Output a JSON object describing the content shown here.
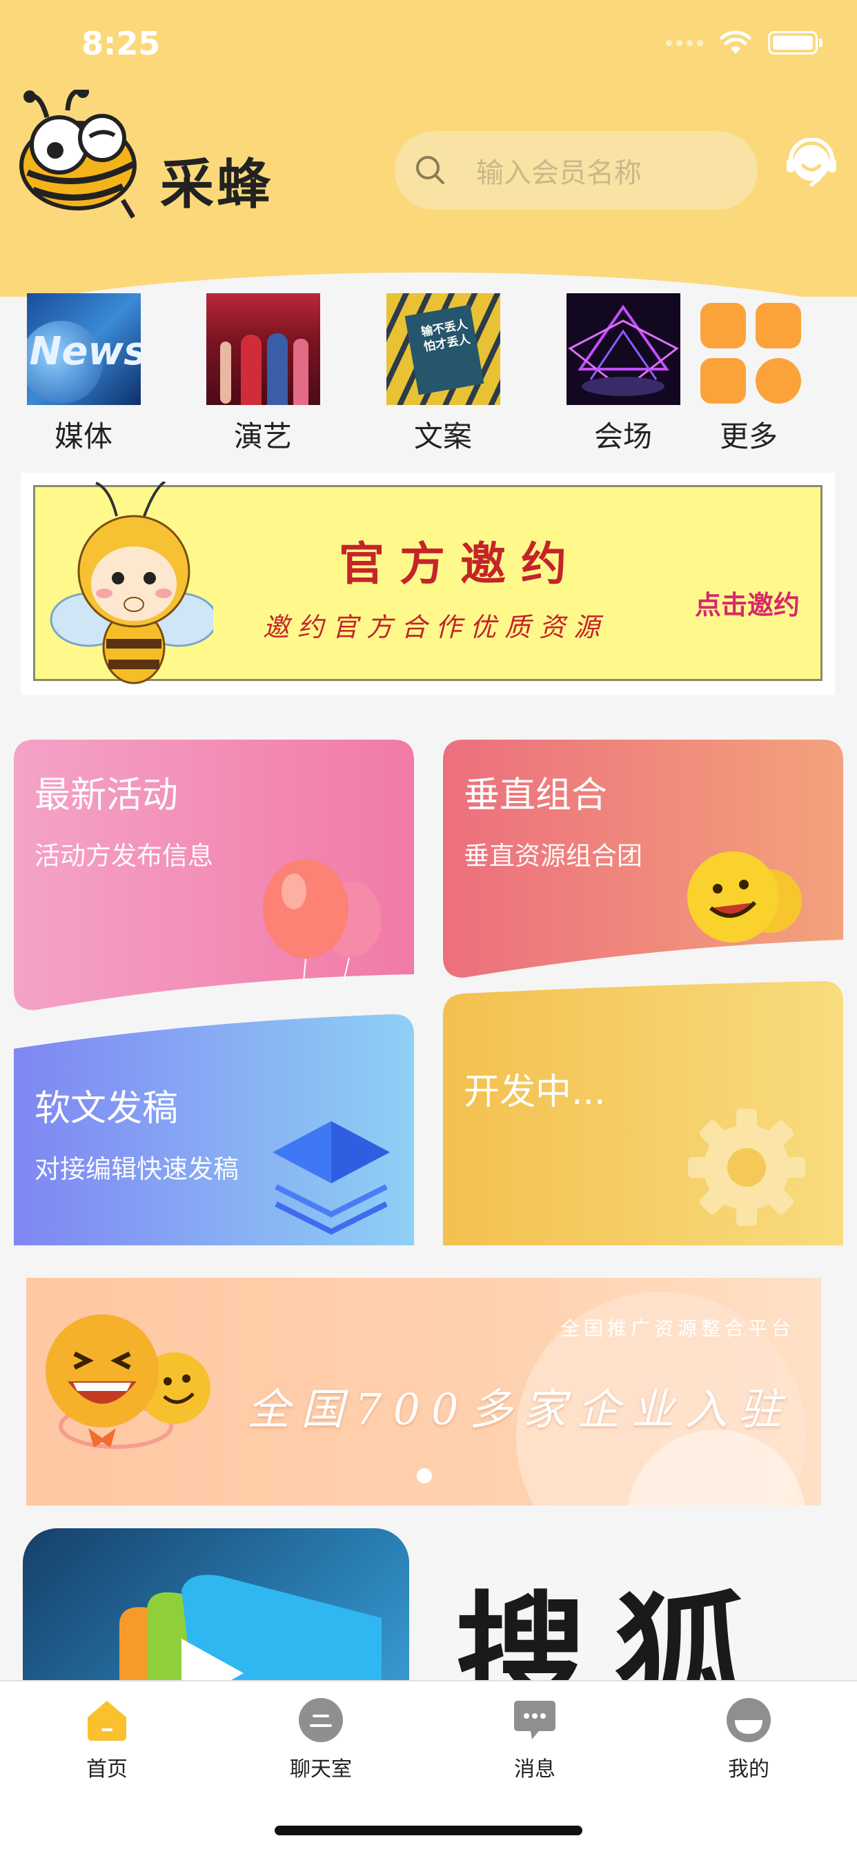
{
  "status": {
    "time": "8:25"
  },
  "header": {
    "title": "采蜂",
    "search_placeholder": "输入会员名称"
  },
  "categories": [
    {
      "label": "媒体",
      "thumb_text": "News"
    },
    {
      "label": "演艺"
    },
    {
      "label": "文案",
      "thumb_text": "输不丢人 怕才丢人"
    },
    {
      "label": "会场"
    },
    {
      "label": "更多"
    }
  ],
  "invite_banner": {
    "title": "官方邀约",
    "subtitle": "邀约官方合作优质资源",
    "button": "点击邀约"
  },
  "cards": [
    {
      "title": "最新活动",
      "subtitle": "活动方发布信息",
      "color_from": "#f4a3c8",
      "color_to": "#f17aa6"
    },
    {
      "title": "垂直组合",
      "subtitle": "垂直资源组合团",
      "color_from": "#ec6f7d",
      "color_to": "#f3a27c"
    },
    {
      "title": "软文发稿",
      "subtitle": "对接编辑快速发稿",
      "color_from": "#7f86f3",
      "color_to": "#8fd0f5"
    },
    {
      "title": "开发中...",
      "subtitle": "",
      "color_from": "#f3c04f",
      "color_to": "#f8dc7e"
    }
  ],
  "promo_banner": {
    "tagline": "全国推广资源整合平台",
    "headline": "全国700多家企业入驻"
  },
  "tiles": [
    {
      "text": ""
    },
    {
      "text": "搜狐"
    }
  ],
  "tabbar": [
    {
      "label": "首页",
      "active": true
    },
    {
      "label": "聊天室"
    },
    {
      "label": "消息"
    },
    {
      "label": "我的"
    }
  ],
  "colors": {
    "header_bg": "#fbd97a",
    "accent": "#fbc02d",
    "tab_icon": "#8f8f8f"
  }
}
